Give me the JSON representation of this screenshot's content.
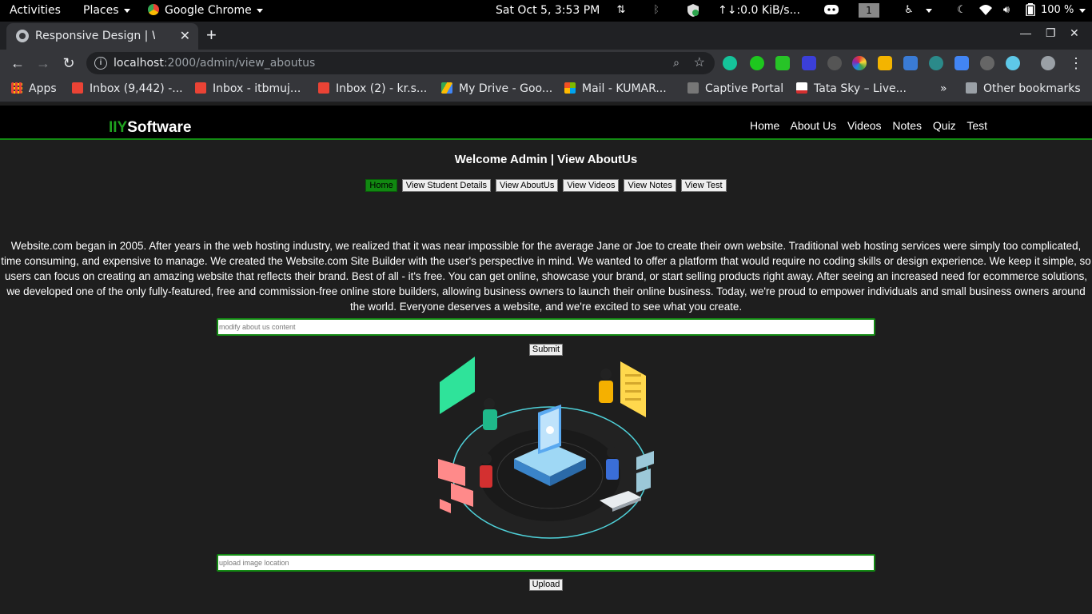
{
  "system_bar": {
    "activities": "Activities",
    "places": "Places",
    "app": "Google Chrome",
    "datetime": "Sat Oct  5,  3:53 PM",
    "network_speed": "↑↓:0.0 KiB/s...",
    "workspace": "1",
    "battery": "100 %"
  },
  "browser": {
    "tab_title": "Responsive Design | Welcome",
    "url_host": "localhost",
    "url_path": ":2000/admin/view_aboutus",
    "bookmarks": [
      {
        "label": "Apps",
        "color": "#e94235"
      },
      {
        "label": "Inbox (9,442) -...",
        "color": "#ea4335"
      },
      {
        "label": "Inbox - itbmuj...",
        "color": "#ea4335"
      },
      {
        "label": "Inbox (2) - kr.s...",
        "color": "#ea4335"
      },
      {
        "label": "My Drive - Goo...",
        "color": "#fbbc04"
      },
      {
        "label": "Mail - KUMAR...",
        "color": "#0078d4"
      },
      {
        "label": "Captive Portal",
        "color": "#9aa0a6"
      },
      {
        "label": "Tata Sky – Live...",
        "color": "#d32f2f"
      }
    ],
    "bookmarks_more": "»",
    "other_bookmarks": "Other bookmarks"
  },
  "site": {
    "brand_prefix": "IIY",
    "brand_suffix": "Software",
    "nav": [
      "Home",
      "About Us",
      "Videos",
      "Notes",
      "Quiz",
      "Test"
    ],
    "heading": "Welcome Admin | View AboutUs",
    "admin_buttons": [
      "Home",
      "View Student Details",
      "View AboutUs",
      "View Videos",
      "View Notes",
      "View Test"
    ],
    "about_text": "Website.com began in 2005. After years in the web hosting industry, we realized that it was near impossible for the average Jane or Joe to create their own website. Traditional web hosting services were simply too complicated, time consuming, and expensive to manage. We created the Website.com Site Builder with the user's perspective in mind. We wanted to offer a platform that would require no coding skills or design experience. We keep it simple, so users can focus on creating an amazing website that reflects their brand. Best of all - it's free. You can get online, showcase your brand, or start selling products right away. After seeing an increased need for ecommerce solutions, we developed one of the only fully-featured, free and commission-free online store builders, allowing business owners to launch their online business. Today, we're proud to empower individuals and small business owners around the world. Everyone deserves a website, and we're excited to see what you create.",
    "modify_placeholder": "modify about us content",
    "submit_label": "Submit",
    "upload_placeholder": "upload image location",
    "upload_label": "Upload"
  },
  "colors": {
    "accent_green": "#138a13",
    "page_bg": "#1e1e1e"
  }
}
